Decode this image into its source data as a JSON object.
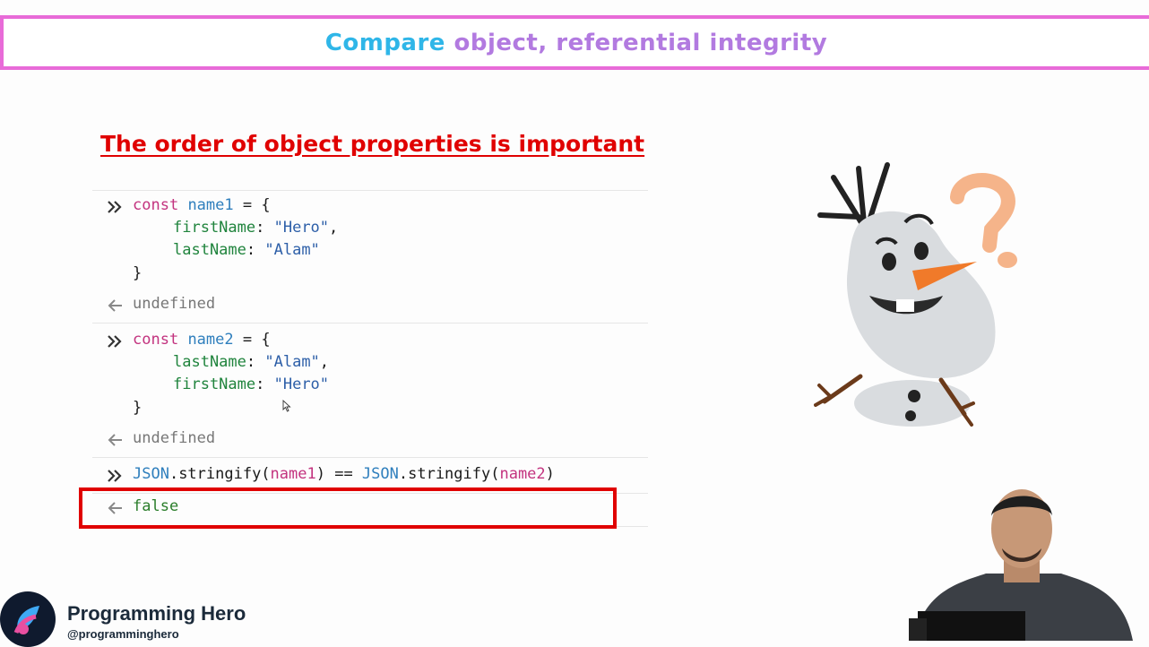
{
  "header": {
    "title_first": "Compare",
    "title_rest": " object, referential integrity"
  },
  "heading": "The order of object properties is important",
  "console": {
    "block1": {
      "l1_kw": "const",
      "l1_var": "name1",
      "l1_rest": " = {",
      "l2_prop": "firstName",
      "l2_colon": ": ",
      "l2_val": "\"Hero\"",
      "l2_end": ",",
      "l3_prop": "lastName",
      "l3_colon": ": ",
      "l3_val": "\"Alam\"",
      "l4": "}",
      "result": "undefined"
    },
    "block2": {
      "l1_kw": "const",
      "l1_var": "name2",
      "l1_rest": " = {",
      "l2_prop": "lastName",
      "l2_colon": ": ",
      "l2_val": "\"Alam\"",
      "l2_end": ",",
      "l3_prop": "firstName",
      "l3_colon": ": ",
      "l3_val": "\"Hero\"",
      "l4": "}",
      "result": "undefined"
    },
    "block3": {
      "expr_a": "JSON",
      "expr_b": ".stringify(",
      "expr_c": "name1",
      "expr_d": ") == ",
      "expr_e": "JSON",
      "expr_f": ".stringify(",
      "expr_g": "name2",
      "expr_h": ")",
      "result": "false"
    }
  },
  "brand": {
    "name": "Programming Hero",
    "handle": "@programminghero"
  },
  "colors": {
    "title_accent": "#2fb6e8",
    "title_rest": "#b27ae0",
    "frame": "#e86bd8",
    "heading": "#e00000",
    "highlight_box": "#e00000"
  },
  "icons": {
    "prompt": "double-chevron-right-icon",
    "result": "arrow-left-icon",
    "illustration": "snowman-question-illustration"
  }
}
